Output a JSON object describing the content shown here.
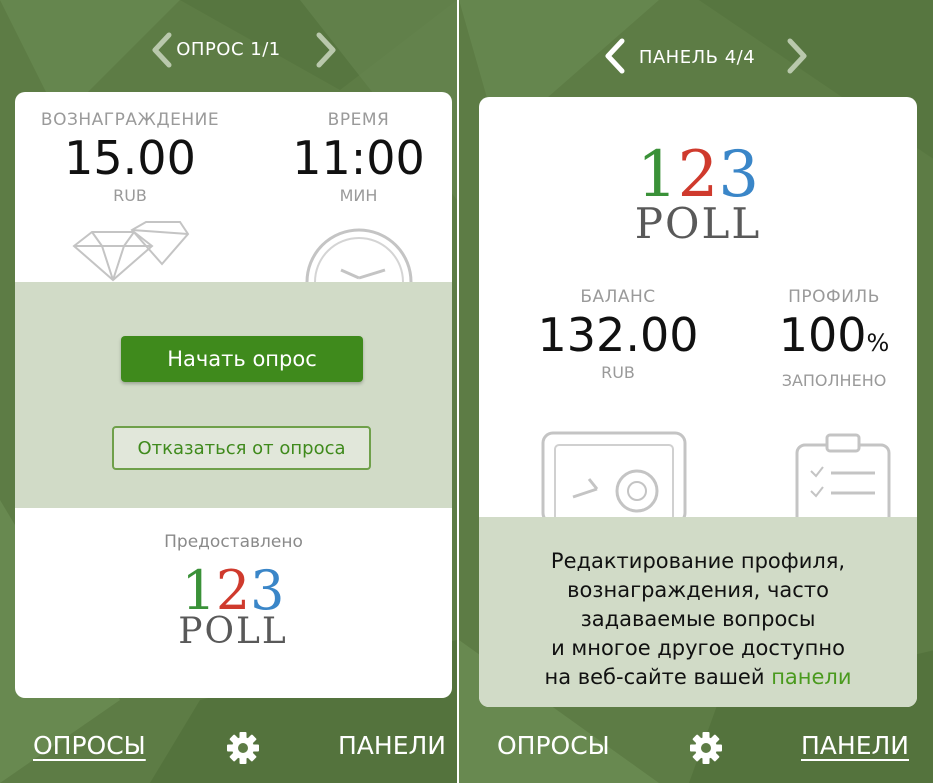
{
  "left_screen": {
    "nav": {
      "title": "ОПРОС 1/1",
      "prev_icon": "chevron-left-icon",
      "next_icon": "chevron-right-icon"
    },
    "reward": {
      "label": "ВОЗНАГРАЖДЕНИЕ",
      "value": "15.00",
      "unit": "RUB",
      "icon": "diamond-icon"
    },
    "time": {
      "label": "ВРЕМЯ",
      "value": "11:00",
      "unit": "МИН",
      "icon": "clock-icon"
    },
    "start_button": "Начать опрос",
    "decline_button": "Отказаться от опроса",
    "provided_by": "Предоставлено",
    "logo": {
      "digits": [
        "1",
        "2",
        "3"
      ],
      "word": "POLL"
    }
  },
  "right_screen": {
    "nav": {
      "title": "ПАНЕЛЬ 4/4",
      "prev_icon": "chevron-left-icon",
      "next_icon": "chevron-right-icon"
    },
    "logo": {
      "digits": [
        "1",
        "2",
        "3"
      ],
      "word": "POLL"
    },
    "balance": {
      "label": "БАЛАНС",
      "value": "132.00",
      "unit": "RUB",
      "icon": "safe-icon"
    },
    "profile": {
      "label": "ПРОФИЛЬ",
      "value": "100",
      "percent": "%",
      "unit": "ЗАПОЛНЕНО",
      "icon": "clipboard-icon"
    },
    "info_lines": [
      "Редактирование профиля,",
      "вознаграждения, часто",
      "задаваемые вопросы",
      "и многое другое доступно"
    ],
    "info_last_prefix": "на веб-сайте вашей ",
    "info_link": "панели"
  },
  "bottom_nav": {
    "surveys": "ОПРОСЫ",
    "settings_icon": "gear-icon",
    "panels": "ПАНЕЛИ"
  },
  "colors": {
    "background": "#5d7c45",
    "primary_button": "#3f8a1c",
    "link": "#4a9a1e",
    "logo_1": "#3a9138",
    "logo_2": "#cf3a2d",
    "logo_3": "#3a86c8"
  }
}
